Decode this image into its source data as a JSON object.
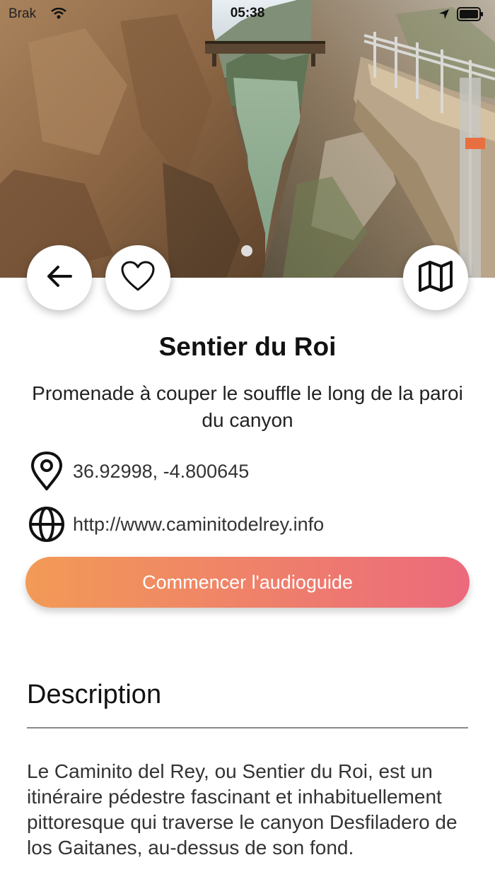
{
  "status_bar": {
    "carrier": "Brak",
    "time": "05:38"
  },
  "hero": {
    "image_description_icon": "canyon-photo",
    "active_page": 1,
    "page_count": 1
  },
  "buttons": {
    "back_icon": "arrow-left-icon",
    "favorite_icon": "heart-icon",
    "map_icon": "map-icon"
  },
  "place": {
    "title": "Sentier du Roi",
    "subtitle": "Promenade à couper le souffle le long de la paroi du canyon",
    "coordinates": "36.92998, -4.800645",
    "website": "http://www.caminitodelrey.info"
  },
  "cta": {
    "label": "Commencer l'audioguide",
    "gradient_start": "#f29a56",
    "gradient_end": "#ec6a7c"
  },
  "description": {
    "heading": "Description",
    "body": "Le Caminito del Rey, ou Sentier du Roi, est un itinéraire pédestre fascinant et inhabituellement pittoresque qui traverse le canyon Desfiladero de los Gaitanes, au-dessus de son fond."
  }
}
